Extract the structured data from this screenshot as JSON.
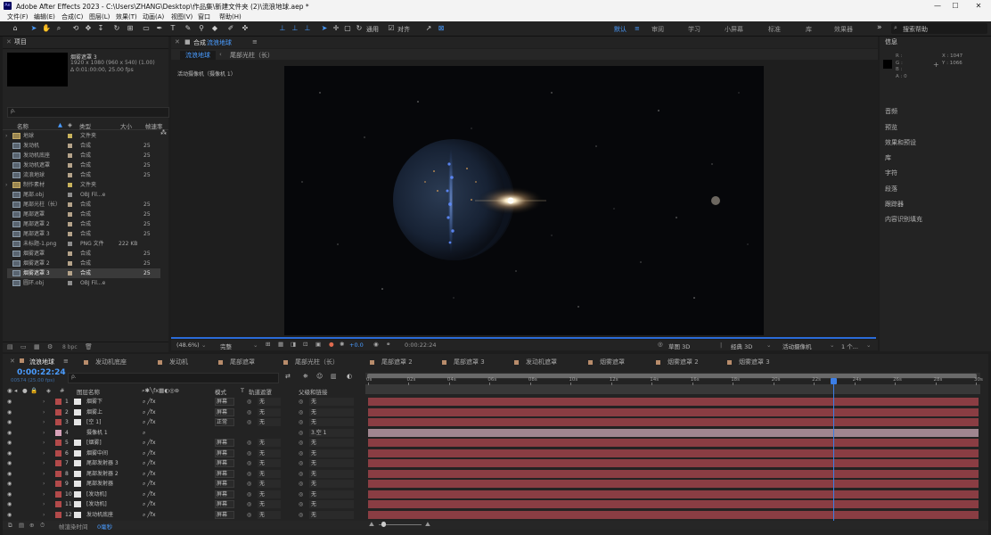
{
  "window": {
    "title": "Adobe After Effects 2023 - C:\\Users\\ZHANG\\Desktop\\作品集\\新建文件夹 (2)\\流浪地球.aep *",
    "logo": "Ae",
    "min": "—",
    "max": "☐",
    "close": "✕"
  },
  "menu": [
    "文件(F)",
    "编辑(E)",
    "合成(C)",
    "图层(L)",
    "效果(T)",
    "动画(A)",
    "视图(V)",
    "窗口",
    "帮助(H)"
  ],
  "toolbar": {
    "snap_label": "对齐",
    "universal_label": "通用",
    "workspaces": [
      "默认",
      "审阅",
      "学习",
      "小屏幕",
      "标准",
      "库",
      "效果器"
    ],
    "search_placeholder": "搜索帮助",
    "more": "»"
  },
  "project": {
    "panel_title": "项目",
    "selected_name": "烟雾遮罩 3",
    "selected_info": [
      "1920 x 1080 (960 x 540) (1.00)",
      "Δ 0:01:00:00, 25.00 fps"
    ],
    "search_placeholder": "ρ.",
    "columns": [
      "名称",
      "类型",
      "大小",
      "帧速率"
    ],
    "items": [
      {
        "name": "地球",
        "type": "文件夹",
        "size": "",
        "fps": "",
        "label": "#c9b35c"
      },
      {
        "name": "发动机",
        "type": "合成",
        "size": "",
        "fps": "25",
        "label": "#b5a38a"
      },
      {
        "name": "发动机底座",
        "type": "合成",
        "size": "",
        "fps": "25",
        "label": "#b5a38a"
      },
      {
        "name": "发动机遮罩",
        "type": "合成",
        "size": "",
        "fps": "25",
        "label": "#b5a38a"
      },
      {
        "name": "流浪地球",
        "type": "合成",
        "size": "",
        "fps": "25",
        "label": "#b5a38a"
      },
      {
        "name": "制作素材",
        "type": "文件夹",
        "size": "",
        "fps": "",
        "label": "#c9b35c"
      },
      {
        "name": "尾部.obj",
        "type": "OBJ Fil...e",
        "size": "",
        "fps": "",
        "label": "#8e8e8e"
      },
      {
        "name": "尾部光柱（长）",
        "type": "合成",
        "size": "",
        "fps": "25",
        "label": "#b5a38a"
      },
      {
        "name": "尾部遮罩",
        "type": "合成",
        "size": "",
        "fps": "25",
        "label": "#b5a38a"
      },
      {
        "name": "尾部遮罩 2",
        "type": "合成",
        "size": "",
        "fps": "25",
        "label": "#b5a38a"
      },
      {
        "name": "尾部遮罩 3",
        "type": "合成",
        "size": "",
        "fps": "25",
        "label": "#b5a38a"
      },
      {
        "name": "未标题-1.png",
        "type": "PNG 文件",
        "size": "222 KB",
        "fps": "",
        "label": "#8e8e8e"
      },
      {
        "name": "烟雾遮罩",
        "type": "合成",
        "size": "",
        "fps": "25",
        "label": "#b5a38a"
      },
      {
        "name": "烟雾遮罩 2",
        "type": "合成",
        "size": "",
        "fps": "25",
        "label": "#b5a38a"
      },
      {
        "name": "烟雾遮罩 3",
        "type": "合成",
        "size": "",
        "fps": "25",
        "label": "#b5a38a"
      },
      {
        "name": "圆环.obj",
        "type": "OBJ Fil...e",
        "size": "",
        "fps": "",
        "label": "#8e8e8e"
      }
    ],
    "bpc": "8 bpc"
  },
  "composition": {
    "panel_title": "合成",
    "comp_name": "流浪地球",
    "breadcrumb": [
      "流浪地球",
      "尾部光柱（长）"
    ],
    "camera_label": "活动摄像机（摄像机 1）",
    "zoom": "(48.6%)",
    "resolution": "完整",
    "exposure": "+0.0",
    "timecode": "0:00:22:24",
    "renderer": "草图 3D",
    "view_3d": "经典 3D",
    "camera": "活动摄像机",
    "views": "1 个..."
  },
  "info_panel": {
    "title": "信息",
    "rgba": [
      "R :",
      "G :",
      "B :",
      "A : 0"
    ],
    "x": "X : 1047",
    "y": "Y : 1066",
    "items": [
      "音频",
      "预览",
      "效果和预设",
      "库",
      "字符",
      "段落",
      "跟踪器",
      "内容识别填充"
    ]
  },
  "timeline": {
    "tabs": [
      "流浪地球",
      "发动机底座",
      "发动机",
      "尾部遮罩",
      "尾部光柱（长）",
      "尾部遮罩 2",
      "尾部遮罩 3",
      "发动机遮罩",
      "烟雾遮罩",
      "烟雾遮罩 2",
      "烟雾遮罩 3"
    ],
    "timecode": "0:00:22:24",
    "frame_info": "00574 (25.00 fps)",
    "search_placeholder": "ρ.",
    "columns": [
      "#",
      "图层名称",
      "模式",
      "T",
      "轨道遮罩",
      "父级和链接"
    ],
    "ruler": [
      "0s",
      "02s",
      "04s",
      "06s",
      "08s",
      "10s",
      "12s",
      "14s",
      "16s",
      "18s",
      "20s",
      "22s",
      "24s",
      "26s",
      "28s",
      "30s"
    ],
    "current_time_fraction": 0.7655,
    "layers": [
      {
        "num": "1",
        "name": "烟雾下",
        "mode": "屏幕",
        "track": "无",
        "parent": "无"
      },
      {
        "num": "2",
        "name": "烟雾上",
        "mode": "屏幕",
        "track": "无",
        "parent": "无"
      },
      {
        "num": "3",
        "name": "[空 1]",
        "mode": "正常",
        "track": "无",
        "parent": "无"
      },
      {
        "num": "4",
        "name": "摄像机 1",
        "mode": "",
        "track": "",
        "parent": "3.空 1"
      },
      {
        "num": "5",
        "name": "[烟雾]",
        "mode": "屏幕",
        "track": "无",
        "parent": "无"
      },
      {
        "num": "6",
        "name": "烟雾中间",
        "mode": "屏幕",
        "track": "无",
        "parent": "无"
      },
      {
        "num": "7",
        "name": "尾部发射器 3",
        "mode": "屏幕",
        "track": "无",
        "parent": "无"
      },
      {
        "num": "8",
        "name": "尾部发射器 2",
        "mode": "屏幕",
        "track": "无",
        "parent": "无"
      },
      {
        "num": "9",
        "name": "尾部发射器",
        "mode": "屏幕",
        "track": "无",
        "parent": "无"
      },
      {
        "num": "10",
        "name": "[发动机]",
        "mode": "屏幕",
        "track": "无",
        "parent": "无"
      },
      {
        "num": "11",
        "name": "[发动机]",
        "mode": "屏幕",
        "track": "无",
        "parent": "无"
      },
      {
        "num": "12",
        "name": "发动机底座",
        "mode": "屏幕",
        "track": "无",
        "parent": "无"
      }
    ],
    "footer_label": "帧渲染时间",
    "footer_value": "0毫秒"
  }
}
